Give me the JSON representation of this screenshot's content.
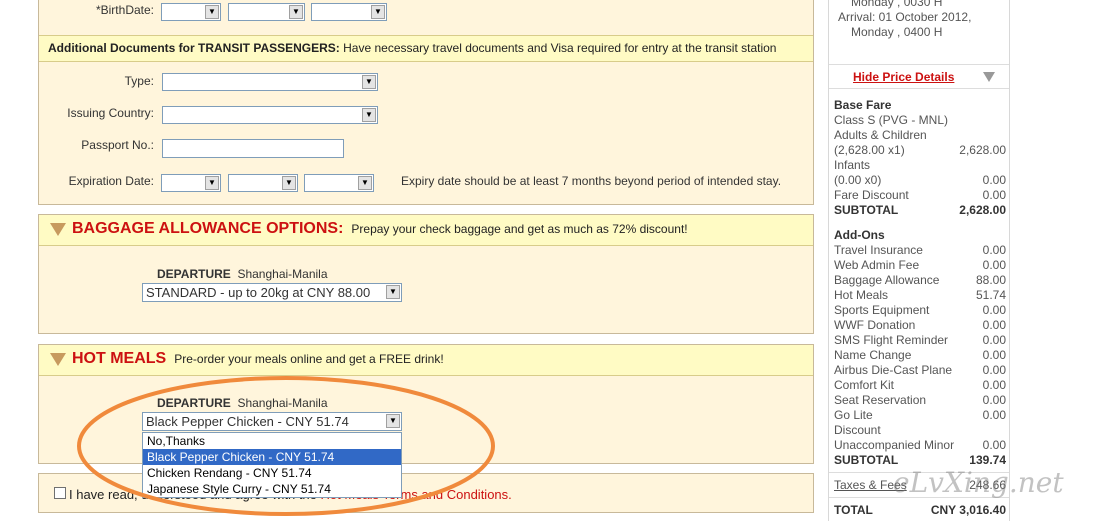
{
  "personal": {
    "birthdate_label": "*BirthDate:",
    "transit_heading": "Additional Documents for TRANSIT PASSENGERS:",
    "transit_note": "Have necessary travel documents and Visa required for entry at the transit station",
    "type_label": "Type:",
    "issuing_country_label": "Issuing Country:",
    "passport_label": "Passport No.:",
    "expiration_label": "Expiration Date:",
    "expiry_note": "Expiry date should be at least 7 months beyond period of intended stay."
  },
  "baggage": {
    "title": "BAGGAGE ALLOWANCE OPTIONS:",
    "subtitle": "Prepay your check baggage and get as much as 72% discount!",
    "departure_label": "DEPARTURE",
    "route": "Shanghai-Manila",
    "selected": "STANDARD - up to 20kg at CNY 88.00"
  },
  "meals": {
    "title": "HOT MEALS",
    "subtitle": "Pre-order your meals online and get a FREE drink!",
    "departure_label": "DEPARTURE",
    "route": "Shanghai-Manila",
    "selected": "Black Pepper Chicken - CNY 51.74",
    "options": [
      "No,Thanks",
      "Black Pepper Chicken - CNY 51.74",
      "Chicken Rendang - CNY 51.74",
      "Japanese Style Curry - CNY 51.74"
    ]
  },
  "terms": {
    "text_start": "I have read, understood and agree with the",
    "link": "Hot Meals Terms and Conditions."
  },
  "flight": {
    "line1": "Monday , 0030 H",
    "line2": "Arrival: 01 October 2012,",
    "line3": "Monday , 0400 H"
  },
  "price": {
    "toggle": "Hide Price Details",
    "base_fare_heading": "Base Fare",
    "class_line": "Class S (PVG - MNL)",
    "adults_label": "Adults & Children",
    "adults_calc": "(2,628.00 x1)",
    "adults_value": "2,628.00",
    "infants_label": "Infants",
    "infants_calc": "(0.00 x0)",
    "infants_value": "0.00",
    "fare_discount_label": "Fare Discount",
    "fare_discount_value": "0.00",
    "subtotal1_label": "SUBTOTAL",
    "subtotal1_value": "2,628.00",
    "addons_heading": "Add-Ons",
    "addons": [
      {
        "label": "Travel Insurance",
        "value": "0.00"
      },
      {
        "label": "Web Admin Fee",
        "value": "0.00"
      },
      {
        "label": "Baggage Allowance",
        "value": "88.00"
      },
      {
        "label": "Hot Meals",
        "value": "51.74"
      },
      {
        "label": "Sports Equipment",
        "value": "0.00"
      },
      {
        "label": "WWF Donation",
        "value": "0.00"
      },
      {
        "label": "SMS Flight Reminder",
        "value": "0.00"
      },
      {
        "label": "Name Change",
        "value": "0.00"
      },
      {
        "label": "Airbus Die-Cast Plane",
        "value": "0.00"
      },
      {
        "label": "Comfort Kit",
        "value": "0.00"
      },
      {
        "label": "Seat Reservation",
        "value": "0.00"
      },
      {
        "label": "Go Lite",
        "value": "0.00"
      },
      {
        "label": "Discount",
        "value": ""
      },
      {
        "label": "Unaccompanied Minor",
        "value": "0.00"
      }
    ],
    "subtotal2_label": "SUBTOTAL",
    "subtotal2_value": "139.74",
    "taxes_label": "Taxes & Fees",
    "taxes_value": "248.66",
    "total_label": "TOTAL",
    "total_value": "CNY 3,016.40"
  },
  "watermark": "eLvXing.net",
  "colors": {
    "accent_red": "#cc1111",
    "panel_bg": "#fff5dc",
    "highlight_orange": "#f08a3c",
    "link_blue": "#3169c6"
  }
}
